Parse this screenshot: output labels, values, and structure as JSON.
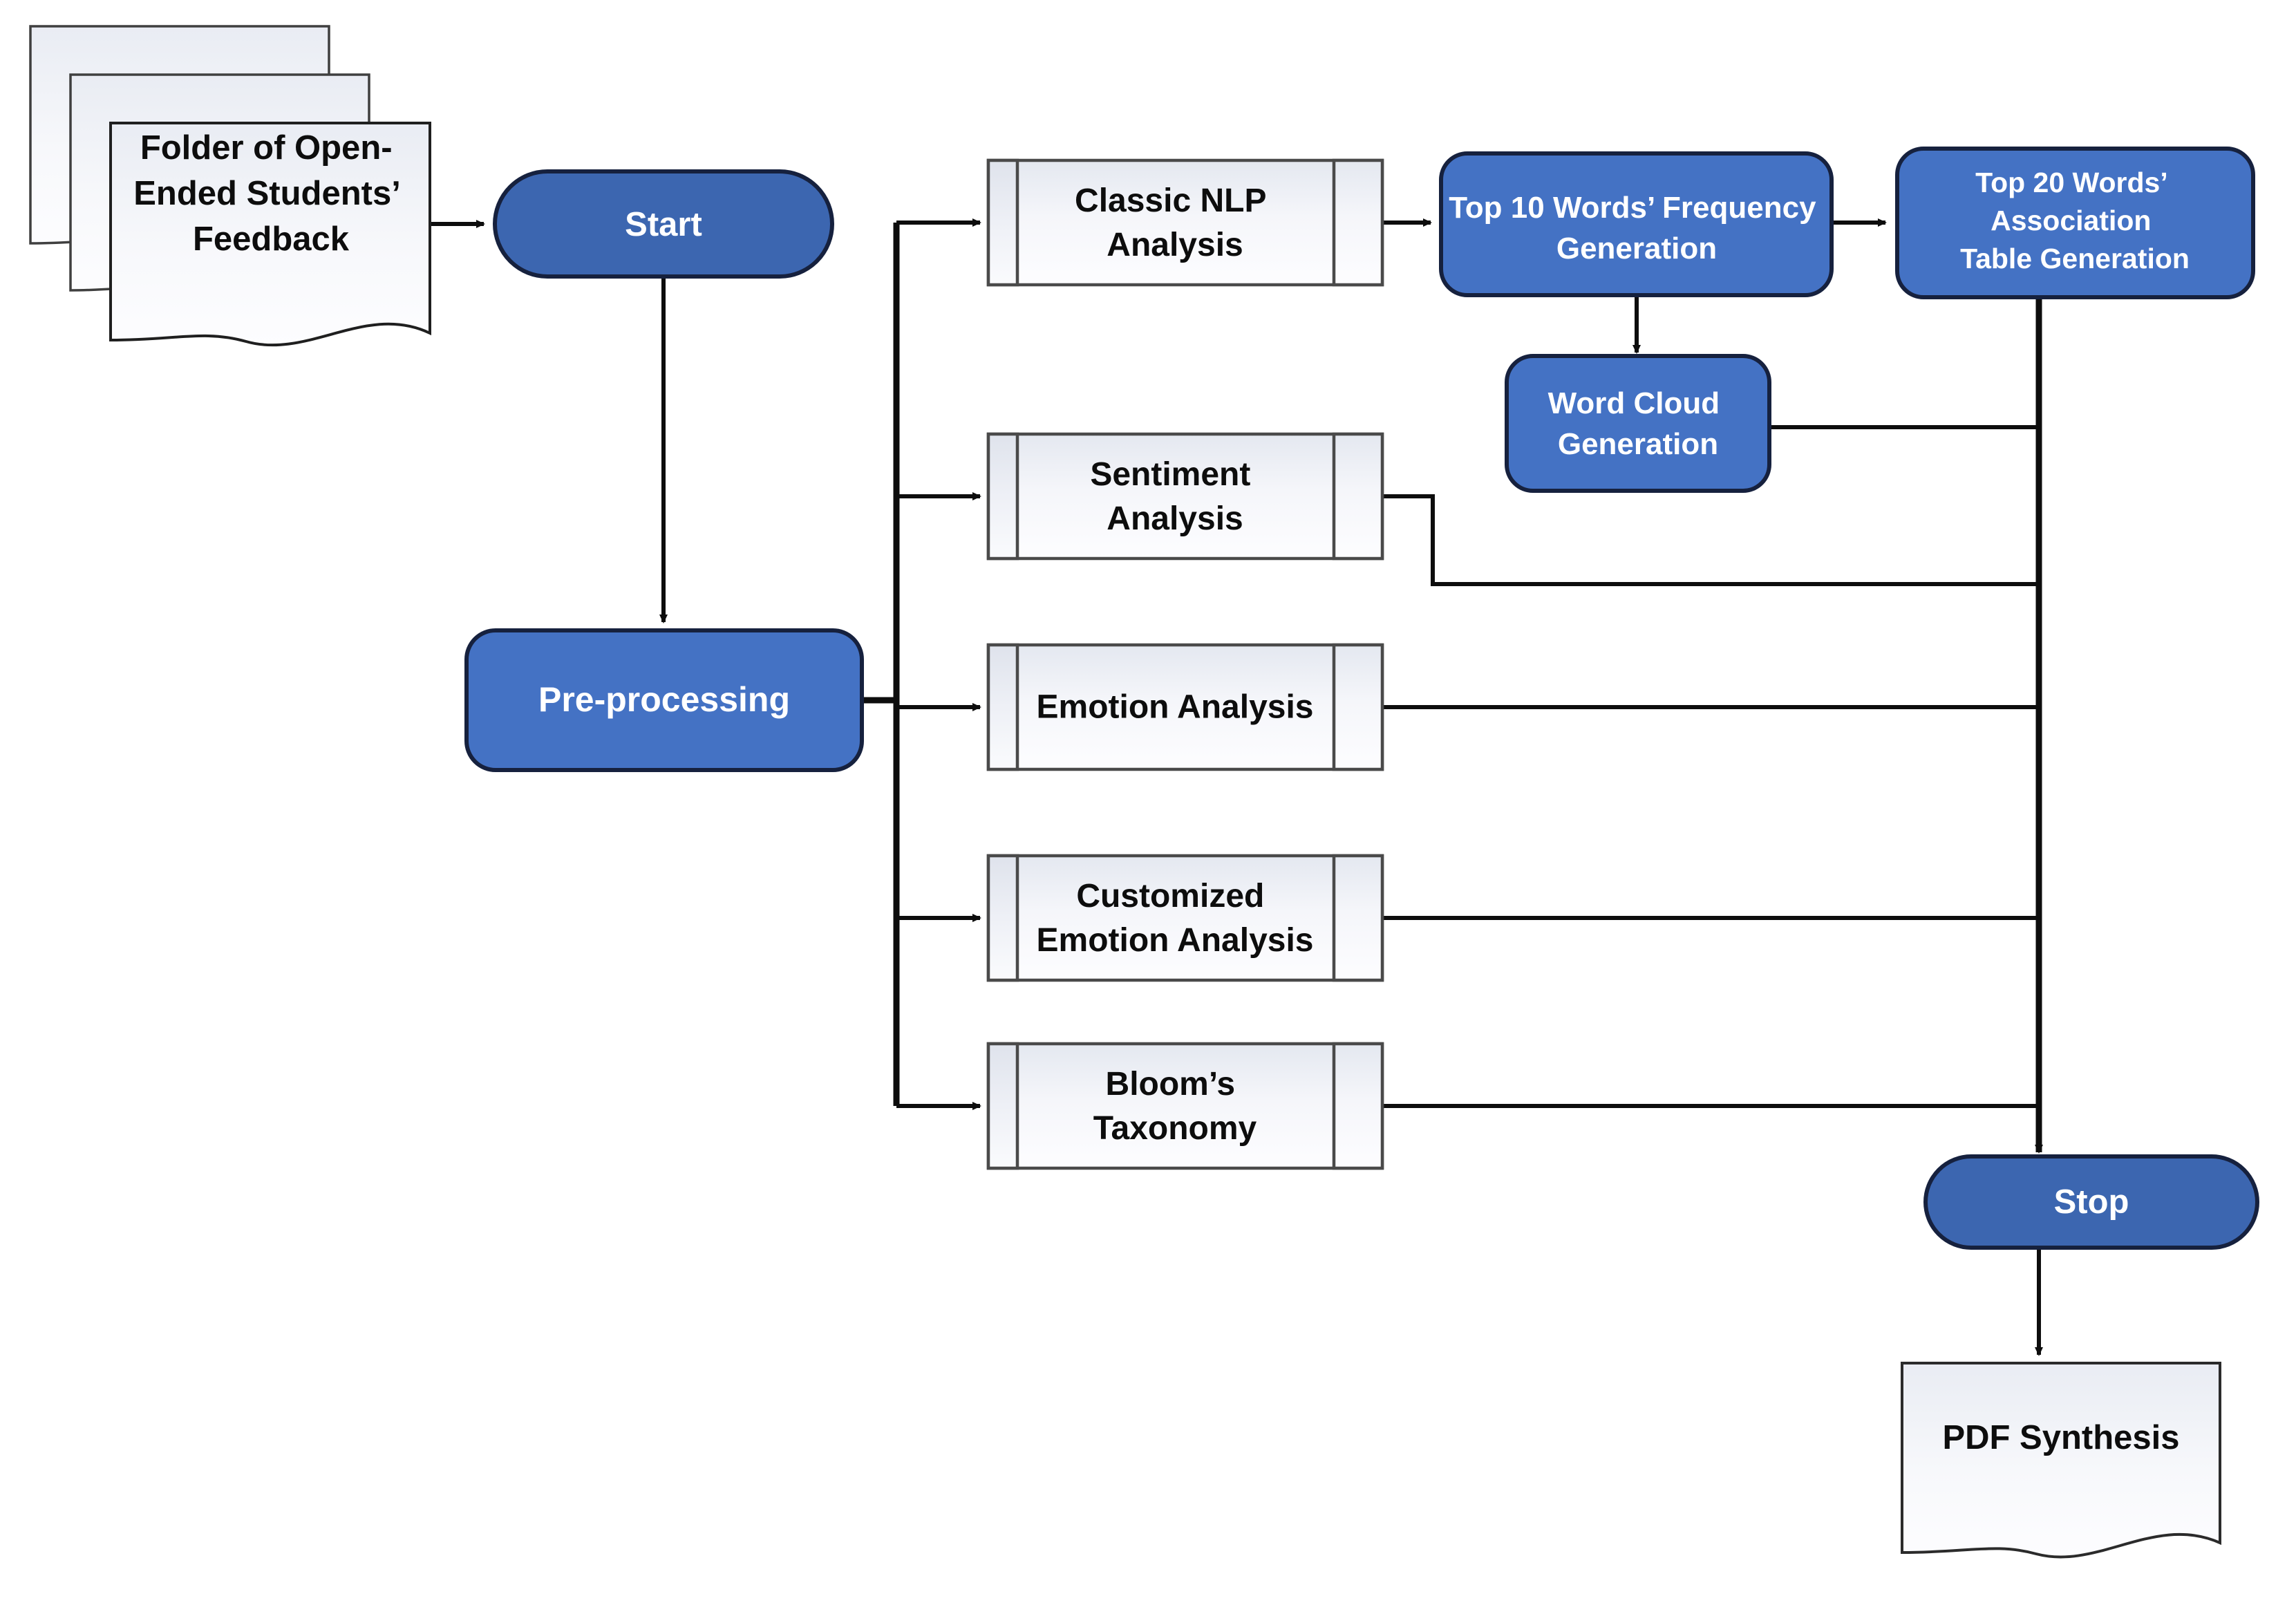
{
  "diagram": {
    "title": "Open-Ended Student Feedback NLP Analysis Pipeline",
    "colors": {
      "terminator_fill": "#3c66b0",
      "process_blue_fill": "#4472c4",
      "document_fill_top": "#eceef4",
      "document_fill_bottom": "#fbfcfe",
      "predefined_fill_top": "#e6e9f0",
      "predefined_fill_bottom": "#fdfdff",
      "outline_dark": "#1a1a2e",
      "outline_gray": "#595959",
      "connector": "#0d0d0d",
      "text_light": "#ffffff",
      "text_dark": "#0d0d0d",
      "page_background": "#ffffff"
    }
  },
  "nodes": {
    "input_document": {
      "label_lines": [
        "Folder of Open-",
        "Ended Students’",
        "Feedback"
      ],
      "shape": "multi-document",
      "text_color": "dark"
    },
    "start": {
      "label_lines": [
        "Start"
      ],
      "shape": "terminator",
      "text_color": "light"
    },
    "preprocessing": {
      "label_lines": [
        "Pre-processing"
      ],
      "shape": "rounded-rectangle",
      "text_color": "light"
    },
    "classic_nlp": {
      "label_lines": [
        "Classic NLP",
        "Analysis"
      ],
      "shape": "predefined-process",
      "text_color": "dark"
    },
    "sentiment": {
      "label_lines": [
        "Sentiment",
        "Analysis"
      ],
      "shape": "predefined-process",
      "text_color": "dark"
    },
    "emotion": {
      "label_lines": [
        "Emotion Analysis"
      ],
      "shape": "predefined-process",
      "text_color": "dark"
    },
    "customized_emotion": {
      "label_lines": [
        "Customized",
        "Emotion Analysis"
      ],
      "shape": "predefined-process",
      "text_color": "dark"
    },
    "blooms": {
      "label_lines": [
        "Bloom’s",
        "Taxonomy"
      ],
      "shape": "predefined-process",
      "text_color": "dark"
    },
    "top10_frequency": {
      "label_lines": [
        "Top 10 Words’ Frequency",
        "Generation"
      ],
      "shape": "rounded-rectangle",
      "text_color": "light"
    },
    "top20_association": {
      "label_lines": [
        "Top 20 Words’",
        "Association",
        "Table Generation"
      ],
      "shape": "rounded-rectangle",
      "text_color": "light"
    },
    "word_cloud": {
      "label_lines": [
        "Word Cloud",
        "Generation"
      ],
      "shape": "rounded-rectangle",
      "text_color": "light"
    },
    "stop": {
      "label_lines": [
        "Stop"
      ],
      "shape": "terminator",
      "text_color": "light"
    },
    "pdf_synthesis": {
      "label_lines": [
        "PDF Synthesis"
      ],
      "shape": "document",
      "text_color": "dark"
    }
  },
  "edges": [
    {
      "id": "doc-to-start",
      "from": "input_document",
      "to": "start",
      "arrow": true
    },
    {
      "id": "start-to-preprocessing",
      "from": "start",
      "to": "preprocessing",
      "arrow": true
    },
    {
      "id": "pre-to-classic-nlp",
      "from": "preprocessing",
      "to": "classic_nlp",
      "arrow": true
    },
    {
      "id": "pre-to-sentiment",
      "from": "preprocessing",
      "to": "sentiment",
      "arrow": true
    },
    {
      "id": "pre-to-emotion",
      "from": "preprocessing",
      "to": "emotion",
      "arrow": true
    },
    {
      "id": "pre-to-customized",
      "from": "preprocessing",
      "to": "customized_emotion",
      "arrow": true
    },
    {
      "id": "pre-to-blooms",
      "from": "preprocessing",
      "to": "blooms",
      "arrow": true
    },
    {
      "id": "classic-to-top10",
      "from": "classic_nlp",
      "to": "top10_frequency",
      "arrow": true
    },
    {
      "id": "top10-to-top20",
      "from": "top10_frequency",
      "to": "top20_association",
      "arrow": true
    },
    {
      "id": "top10-to-wordcloud",
      "from": "top10_frequency",
      "to": "word_cloud",
      "arrow": true
    },
    {
      "id": "top20-to-stop",
      "from": "top20_association",
      "to": "stop",
      "arrow": true
    },
    {
      "id": "wordcloud-to-stop",
      "from": "word_cloud",
      "to": "stop",
      "arrow": false
    },
    {
      "id": "sentiment-to-stop",
      "from": "sentiment",
      "to": "stop",
      "arrow": false
    },
    {
      "id": "emotion-to-stop",
      "from": "emotion",
      "to": "stop",
      "arrow": false
    },
    {
      "id": "customized-to-stop",
      "from": "customized_emotion",
      "to": "stop",
      "arrow": false
    },
    {
      "id": "blooms-to-stop",
      "from": "blooms",
      "to": "stop",
      "arrow": false
    },
    {
      "id": "stop-to-pdf",
      "from": "stop",
      "to": "pdf_synthesis",
      "arrow": true
    }
  ]
}
